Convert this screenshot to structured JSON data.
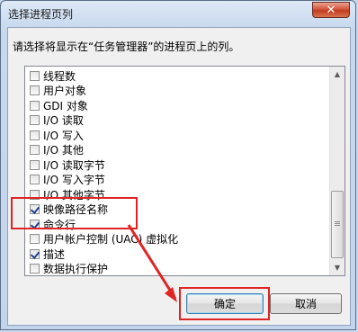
{
  "dialog": {
    "title": "选择进程页列",
    "close_label": "✕",
    "prompt": "请选择将显示在“任务管理器”的进程页上的列。"
  },
  "columns": [
    {
      "label": "线程数",
      "checked": false
    },
    {
      "label": "用户对象",
      "checked": false
    },
    {
      "label": "GDI 对象",
      "checked": false
    },
    {
      "label": "I/O 读取",
      "checked": false
    },
    {
      "label": "I/O 写入",
      "checked": false
    },
    {
      "label": "I/O 其他",
      "checked": false
    },
    {
      "label": "I/O 读取字节",
      "checked": false
    },
    {
      "label": "I/O 写入字节",
      "checked": false
    },
    {
      "label": "I/O 其他字节",
      "checked": false
    },
    {
      "label": "映像路径名称",
      "checked": true
    },
    {
      "label": "命令行",
      "checked": true
    },
    {
      "label": "用户帐户控制 (UAC) 虚拟化",
      "checked": false
    },
    {
      "label": "描述",
      "checked": true
    },
    {
      "label": "数据执行保护",
      "checked": false
    }
  ],
  "buttons": {
    "ok_label": "确定",
    "cancel_label": "取消"
  },
  "colors": {
    "highlight": "#e02424",
    "check": "#1d3f91"
  }
}
